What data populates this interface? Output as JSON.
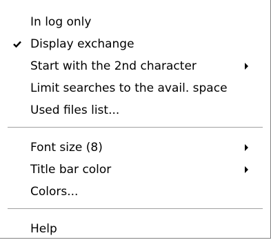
{
  "menu": {
    "items": [
      {
        "label": "In log only"
      },
      {
        "label": "Display exchange",
        "checked": true
      },
      {
        "label": "Start with the 2nd character",
        "submenu": true
      },
      {
        "label": "Limit searches to the avail. space"
      },
      {
        "label": "Used files list..."
      },
      {
        "label": "Font size (8)",
        "submenu": true
      },
      {
        "label": "Title bar color",
        "submenu": true
      },
      {
        "label": "Colors..."
      },
      {
        "label": "Help"
      }
    ]
  },
  "icons": {
    "check": "checkmark-icon",
    "submenu": "chevron-right-icon"
  },
  "colors": {
    "text": "#000000",
    "background": "#ffffff",
    "separator": "#a0a0a0"
  }
}
